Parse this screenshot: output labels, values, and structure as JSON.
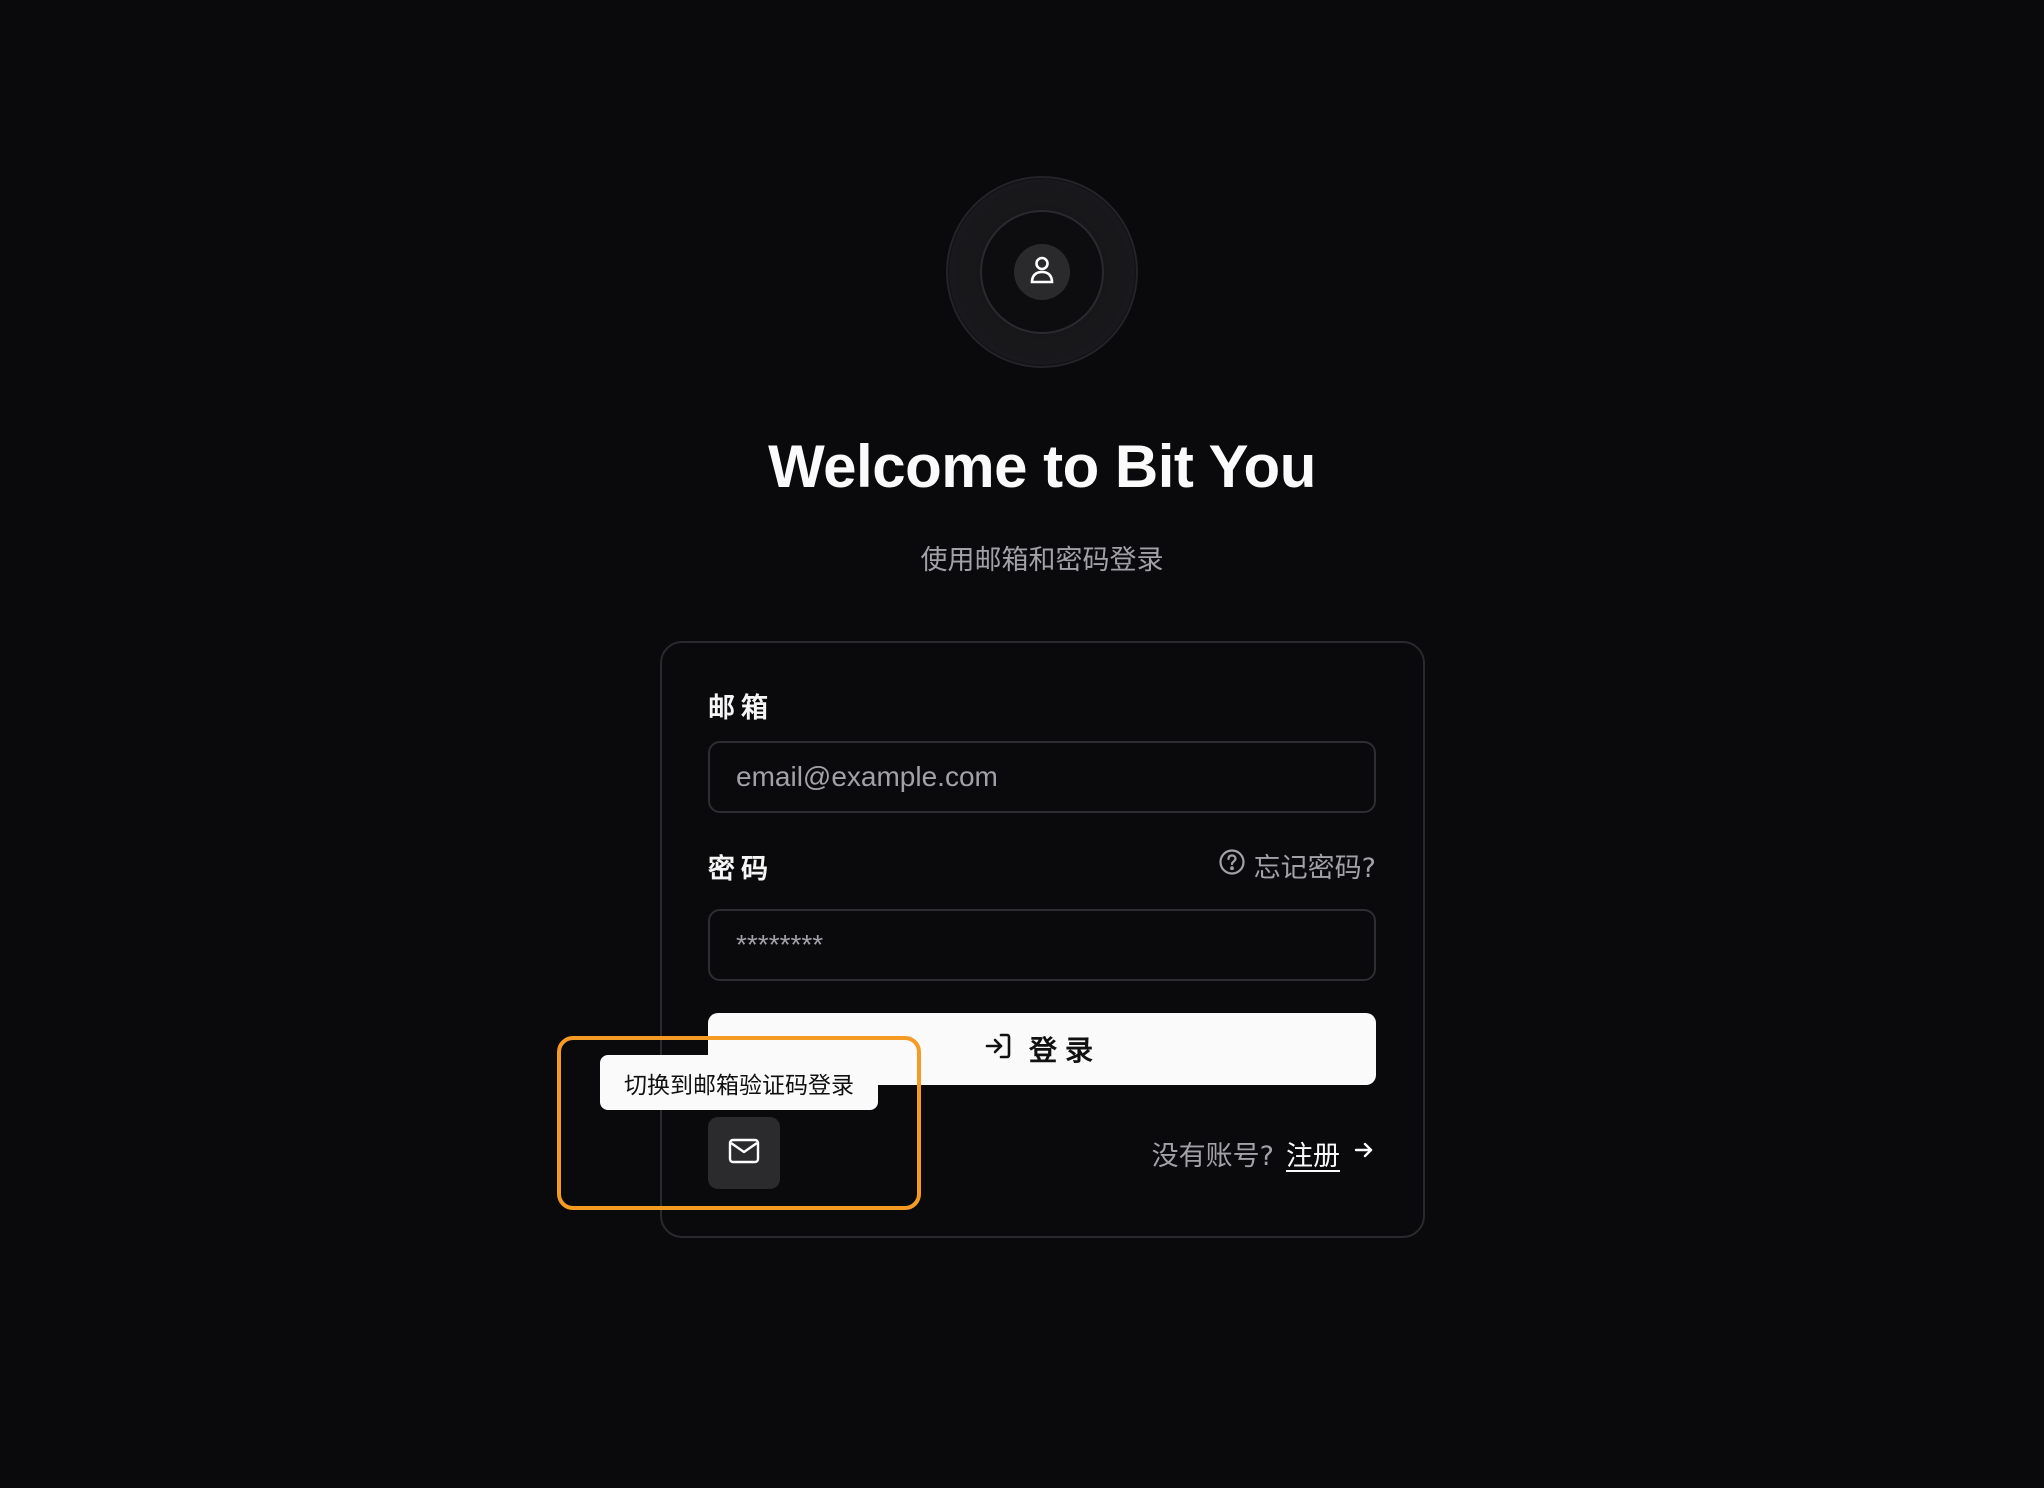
{
  "header": {
    "title": "Welcome to Bit You",
    "subtitle": "使用邮箱和密码登录"
  },
  "form": {
    "email_label": "邮箱",
    "email_placeholder": "email@example.com",
    "password_label": "密码",
    "password_placeholder": "********",
    "forgot_label": "忘记密码?",
    "login_label": "登录",
    "switch_tooltip": "切换到邮箱验证码登录",
    "no_account_text": "没有账号?",
    "signup_label": "注册"
  },
  "icons": {
    "avatar": "user-icon",
    "forgot": "help-circle-icon",
    "login": "log-in-icon",
    "switch": "mail-icon",
    "signup": "arrow-right-icon"
  },
  "colors": {
    "background": "#0a0a0c",
    "primary_button": "#fafafa",
    "highlight": "#f59a23",
    "muted_text": "#a1a1a8"
  }
}
